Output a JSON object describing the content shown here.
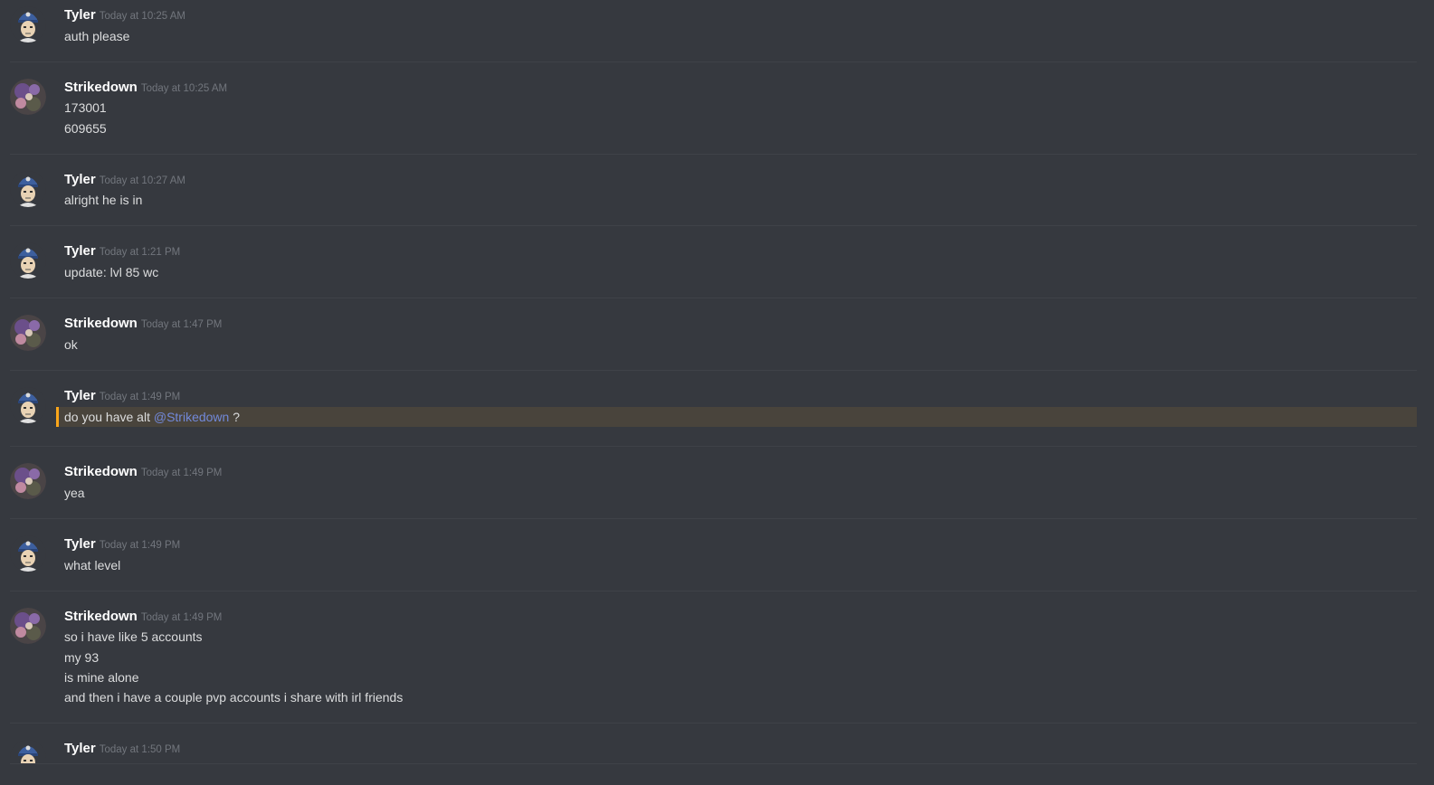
{
  "messages": [
    {
      "author": "Tyler",
      "timestamp": "Today at 10:25 AM",
      "avatar": "tyler-avatar-icon",
      "lines": [
        "auth please"
      ]
    },
    {
      "author": "Strikedown",
      "timestamp": "Today at 10:25 AM",
      "avatar": "strikedown-avatar-icon",
      "lines": [
        "173001",
        "609655"
      ]
    },
    {
      "author": "Tyler",
      "timestamp": "Today at 10:27 AM",
      "avatar": "tyler-avatar-icon",
      "lines": [
        "alright he is in"
      ]
    },
    {
      "author": "Tyler",
      "timestamp": "Today at 1:21 PM",
      "avatar": "tyler-avatar-icon",
      "lines": [
        "update: lvl 85 wc"
      ]
    },
    {
      "author": "Strikedown",
      "timestamp": "Today at 1:47 PM",
      "avatar": "strikedown-avatar-icon",
      "lines": [
        "ok"
      ]
    },
    {
      "author": "Tyler",
      "timestamp": "Today at 1:49 PM",
      "avatar": "tyler-avatar-icon",
      "highlighted": true,
      "lines": [
        "do you have alt "
      ],
      "mention": "@Strikedown",
      "after_mention": " ?"
    },
    {
      "author": "Strikedown",
      "timestamp": "Today at 1:49 PM",
      "avatar": "strikedown-avatar-icon",
      "lines": [
        "yea"
      ]
    },
    {
      "author": "Tyler",
      "timestamp": "Today at 1:49 PM",
      "avatar": "tyler-avatar-icon",
      "lines": [
        "what level"
      ]
    },
    {
      "author": "Strikedown",
      "timestamp": "Today at 1:49 PM",
      "avatar": "strikedown-avatar-icon",
      "lines": [
        "so i have like 5 accounts",
        "my 93",
        "is mine alone",
        "and then i have a couple pvp accounts i share with irl friends"
      ]
    },
    {
      "author": "Tyler",
      "timestamp": "Today at 1:50 PM",
      "avatar": "tyler-avatar-icon",
      "lines": []
    }
  ],
  "colors": {
    "background": "#36393f",
    "author": "#ffffff",
    "timestamp": "#72767d",
    "text": "#dcddde",
    "mention": "#7289da",
    "highlight_bg": "#49443c",
    "highlight_border": "#faa61a"
  }
}
